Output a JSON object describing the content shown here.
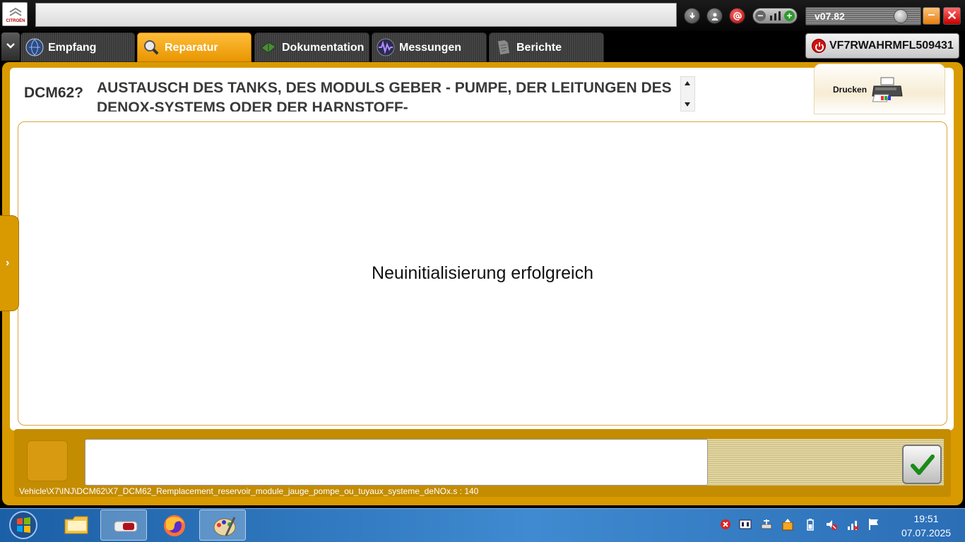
{
  "app": {
    "logo_text": "CITROËN",
    "version": "v07.82",
    "address_value": ""
  },
  "toolbar_icons": [
    "download-icon",
    "user-icon",
    "at-icon",
    "signal-toggle-icon",
    "dial-icon",
    "minimize-icon",
    "close-icon"
  ],
  "tabs": [
    {
      "label": "Empfang",
      "icon": "globe-icon",
      "active": false
    },
    {
      "label": "Reparatur",
      "icon": "magnifier-icon",
      "active": true
    },
    {
      "label": "Dokumentation",
      "icon": "book-icon",
      "active": false
    },
    {
      "label": "Messungen",
      "icon": "waveform-icon",
      "active": false
    },
    {
      "label": "Berichte",
      "icon": "document-icon",
      "active": false
    }
  ],
  "vehicle": {
    "vin": "VF7RWAHRMFL509431"
  },
  "header": {
    "code": "DCM62?",
    "title": "AUSTAUSCH DES TANKS, DES MODULS GEBER - PUMPE, DER LEITUNGEN DES DENOX-SYSTEMS ODER DER HARNSTOFF-"
  },
  "print": {
    "label": "Drucken"
  },
  "content": {
    "message": "Neuinitialisierung erfolgreich"
  },
  "footer": {
    "message_value": "",
    "path": "Vehicle\\X7\\INJ\\DCM62\\X7_DCM62_Remplacement_reservoir_module_jauge_pompe_ou_tuyaux_systeme_deNOx.s : 140"
  },
  "taskbar": {
    "items": [
      "windows-explorer-icon",
      "diagbox-icon",
      "firefox-icon",
      "paint-icon"
    ],
    "tray": [
      "error-icon",
      "keyboard-icon",
      "network-drive-icon",
      "update-icon",
      "battery-icon",
      "mute-icon",
      "signal-icon",
      "flag-icon"
    ],
    "time": "19:51",
    "date": "07.07.2025"
  },
  "colors": {
    "accent": "#d89a00",
    "active_tab": "#f5a500",
    "taskbar": "#2b6eb6"
  }
}
